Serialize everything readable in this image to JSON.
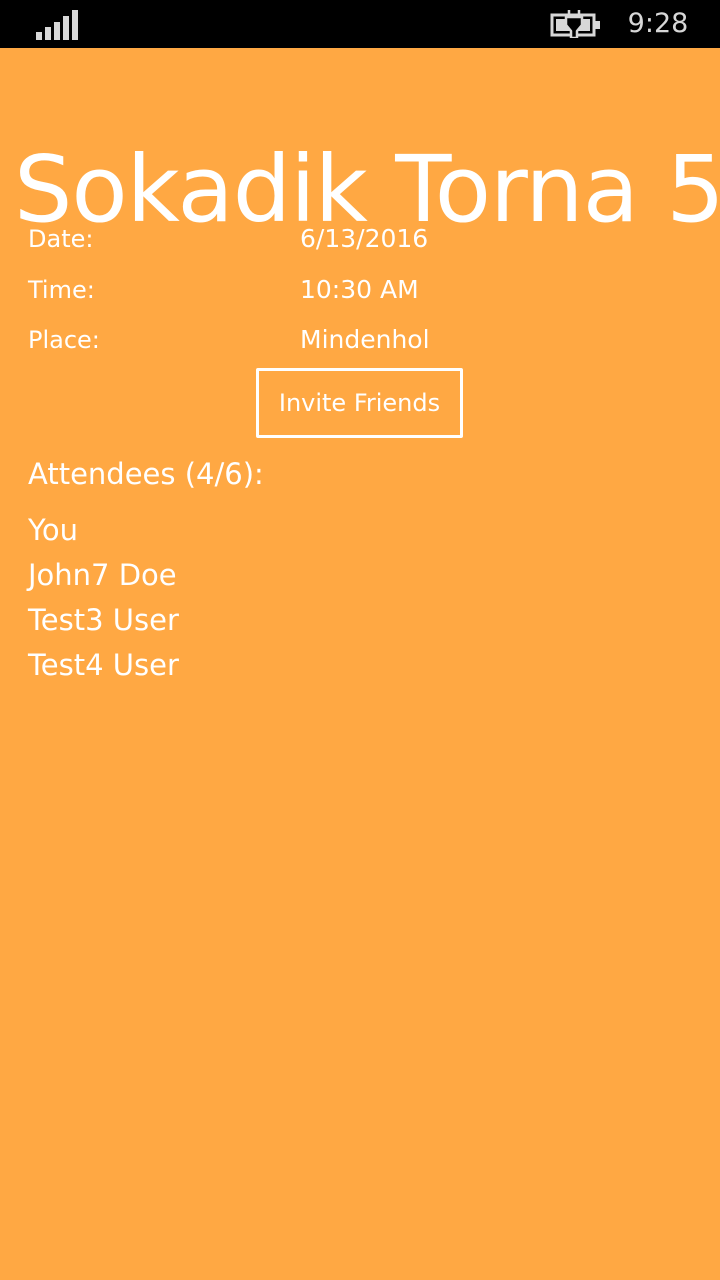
{
  "status_bar": {
    "time": "9:28",
    "signal_icon": "signal-strength-icon",
    "battery_icon": "battery-charging-icon",
    "text_color": "#D7D7D7",
    "background": "#000000"
  },
  "page": {
    "title": "Sokadik Torna 5",
    "background": "#FFA843"
  },
  "details": {
    "date_label": "Date:",
    "date_value": "6/13/2016",
    "time_label": "Time:",
    "time_value": "10:30 AM",
    "place_label": "Place:",
    "place_value": "Mindenhol"
  },
  "actions": {
    "invite_label": "Invite Friends"
  },
  "attendees": {
    "heading": "Attendees (4/6):",
    "items": [
      "You",
      "John7 Doe",
      "Test3 User",
      "Test4 User"
    ]
  }
}
